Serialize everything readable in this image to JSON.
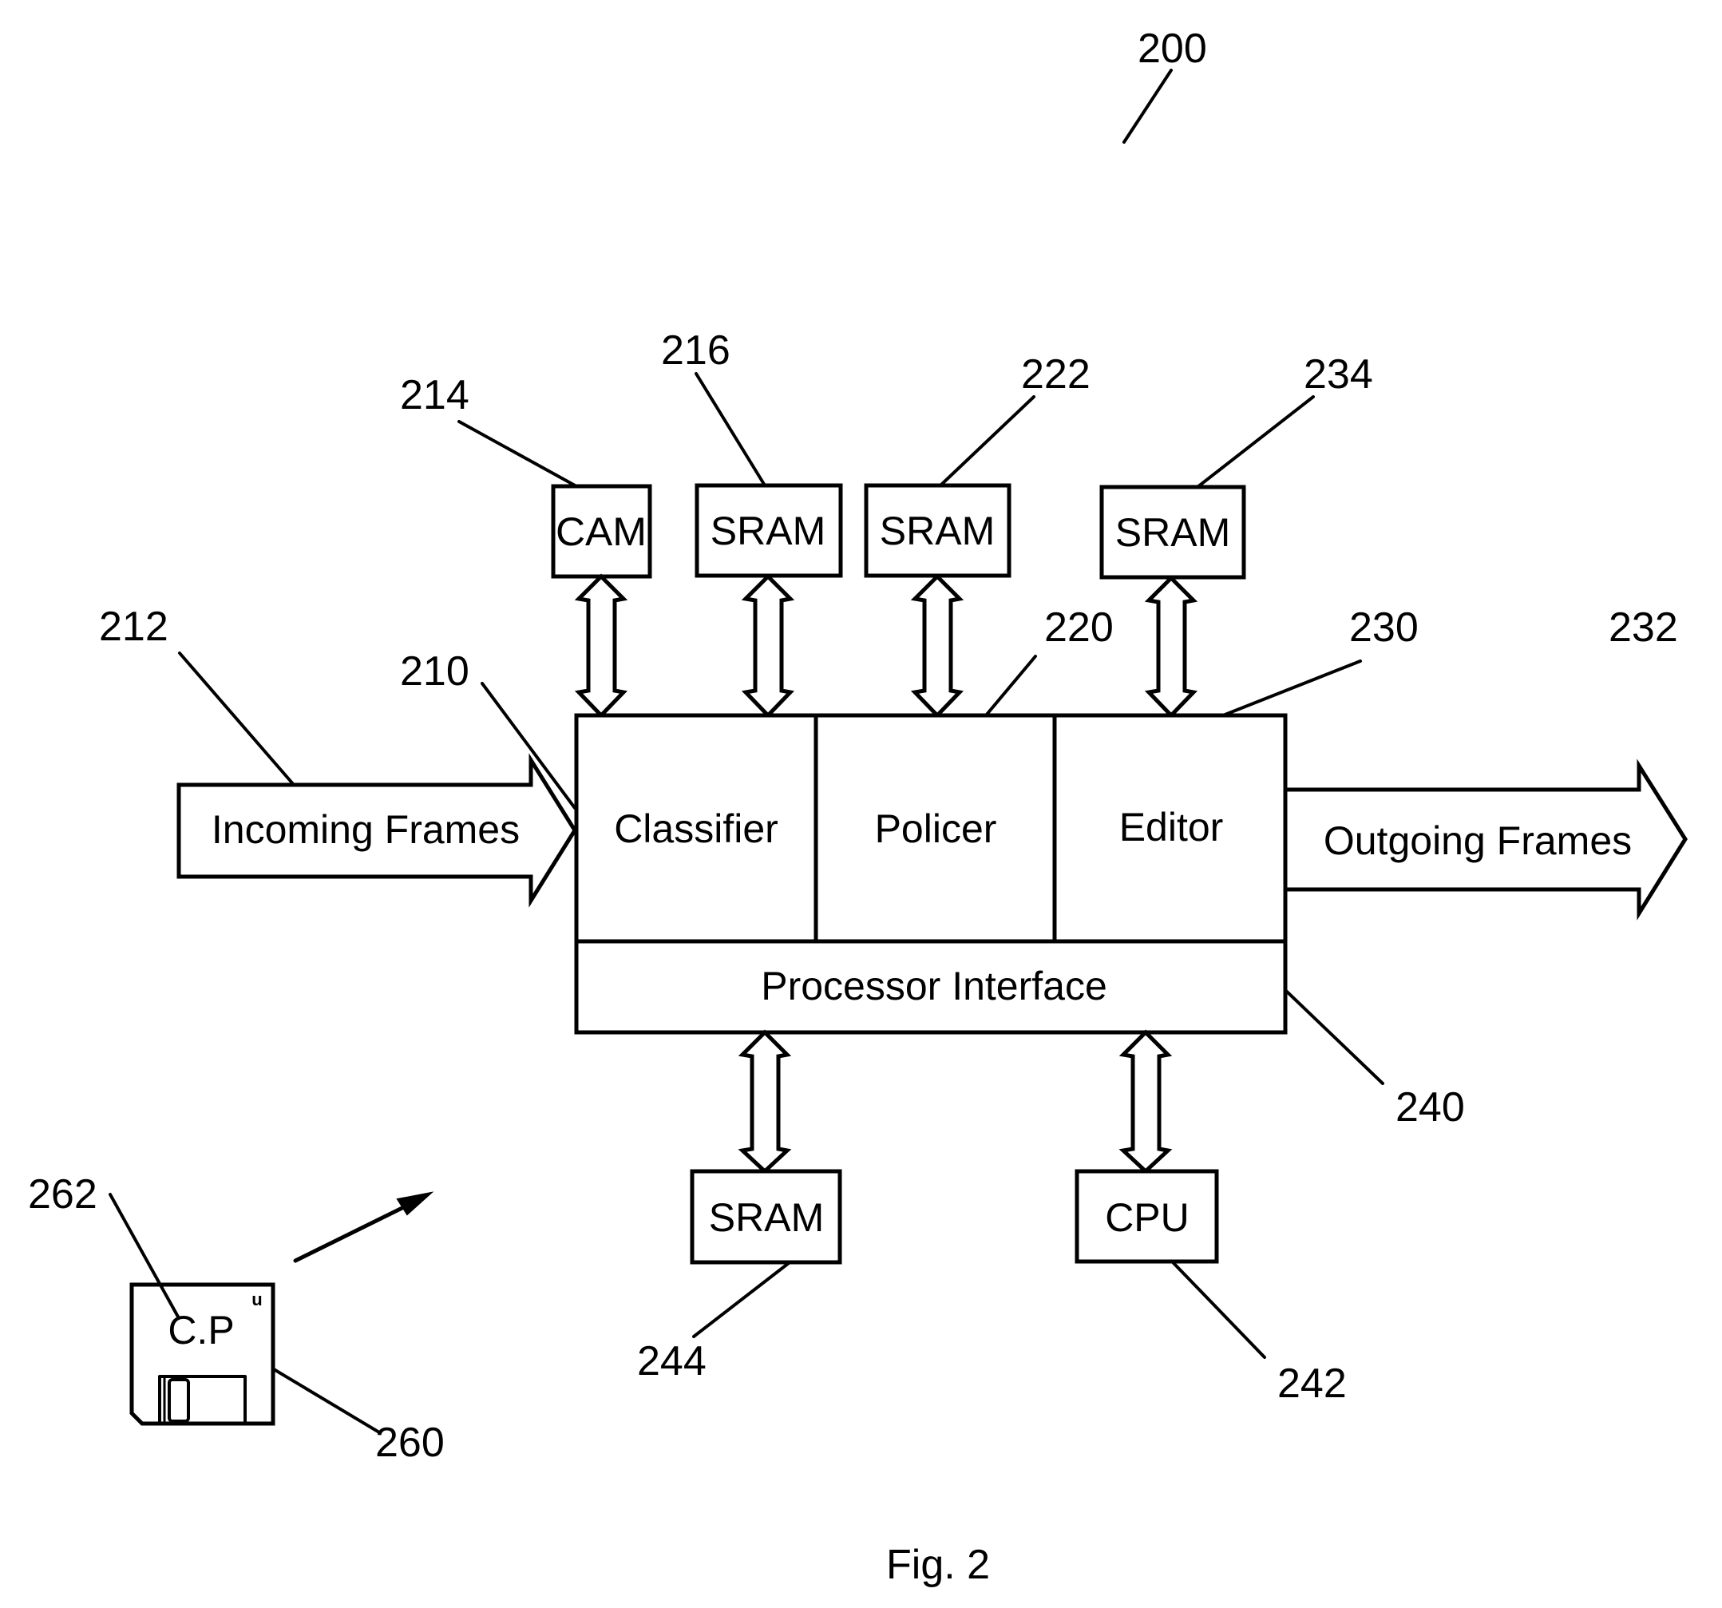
{
  "figure": {
    "caption": "Fig. 2",
    "reference": "200"
  },
  "blocks": {
    "classifier": {
      "label": "Classifier",
      "ref": "210"
    },
    "policer": {
      "label": "Policer",
      "ref": "220"
    },
    "editor": {
      "label": "Editor",
      "ref": "230"
    },
    "processor_interface": {
      "label": "Processor Interface",
      "ref": "240"
    }
  },
  "memories_top": [
    {
      "label": "CAM",
      "ref": "214"
    },
    {
      "label": "SRAM",
      "ref": "216"
    },
    {
      "label": "SRAM",
      "ref": "222"
    },
    {
      "label": "SRAM",
      "ref": "234"
    }
  ],
  "memories_bottom": [
    {
      "label": "SRAM",
      "ref": "244"
    },
    {
      "label": "CPU",
      "ref": "242"
    }
  ],
  "flows": {
    "incoming": {
      "label": "Incoming Frames",
      "ref": "212"
    },
    "outgoing": {
      "label": "Outgoing Frames",
      "ref": "232"
    }
  },
  "storage_medium": {
    "label": "C.P",
    "ref_disk": "260",
    "ref_program": "262",
    "corner_mark": "u"
  }
}
